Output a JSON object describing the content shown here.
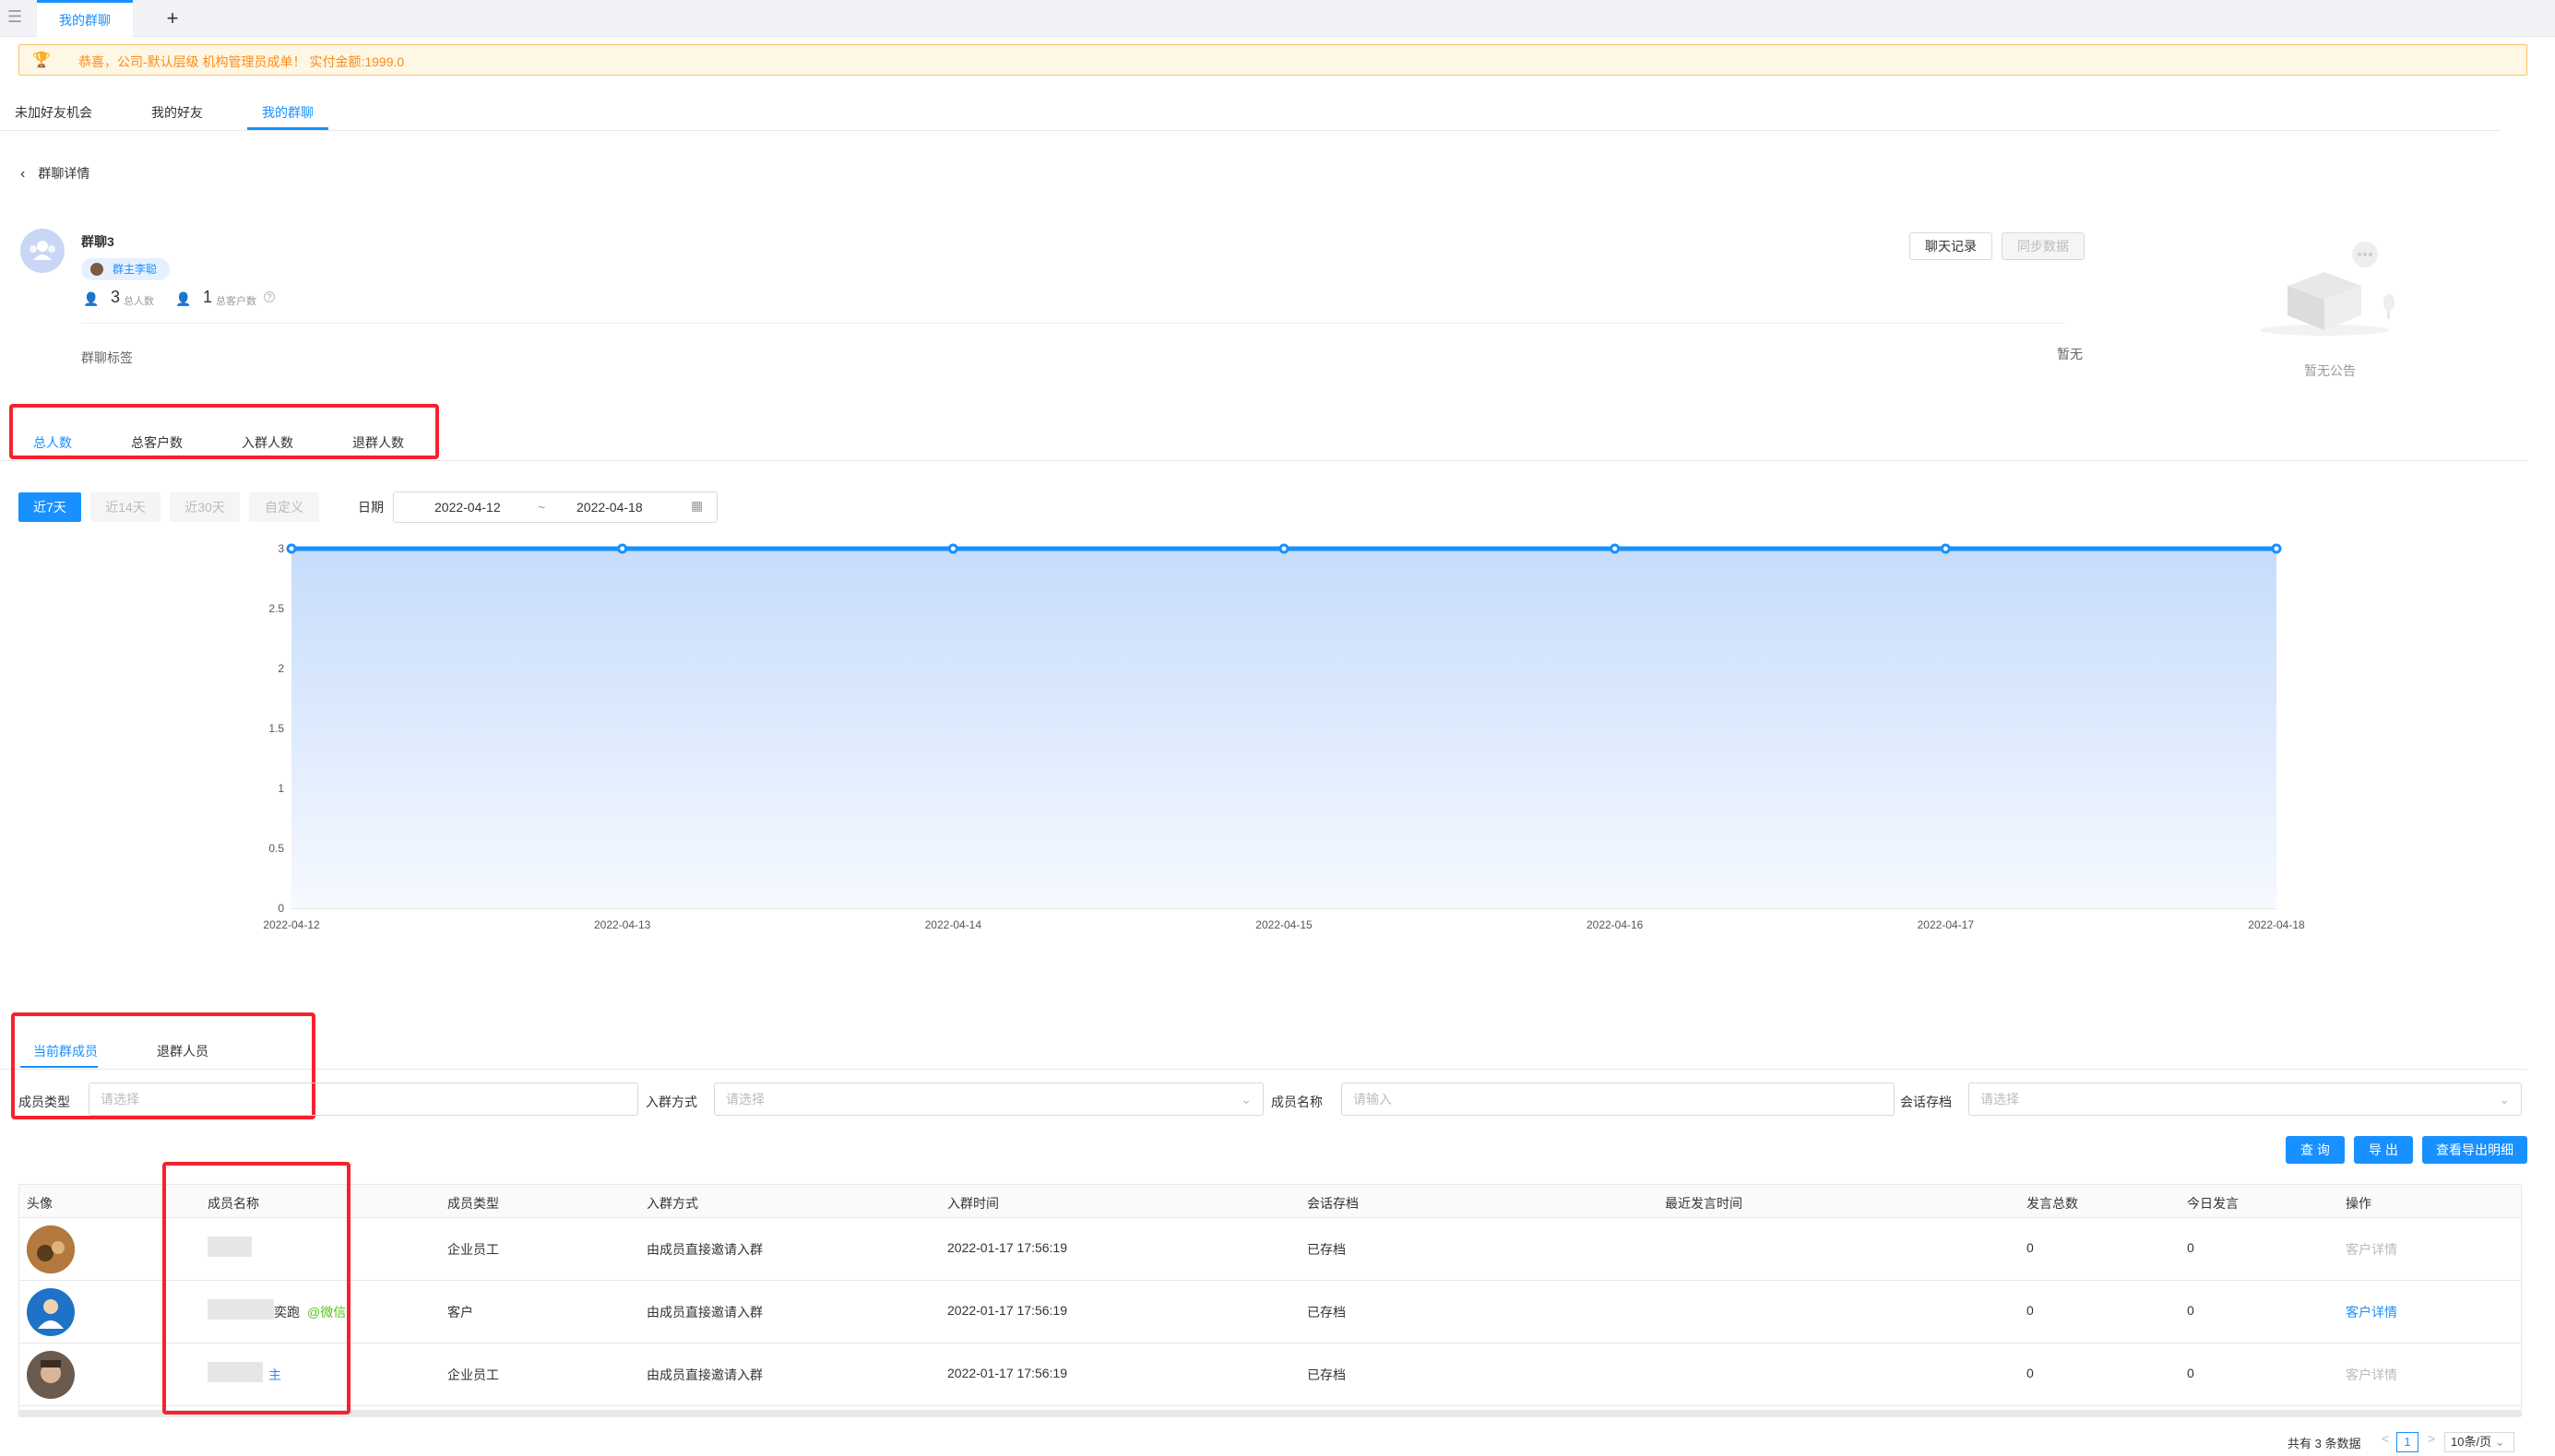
{
  "topbar": {
    "tab_label": "我的群聊",
    "add_symbol": "+"
  },
  "notice": {
    "text": "恭喜，公司-默认层级  机构管理员成单！  实付金额:1999.0"
  },
  "main_tabs": [
    "未加好友机会",
    "我的好友",
    "我的群聊"
  ],
  "back_label": "群聊详情",
  "group": {
    "name": "群聊3",
    "owner_tag": "群主李聪",
    "total_count": "3",
    "total_label": "总人数",
    "customer_count": "1",
    "customer_label": "总客户数",
    "help_icon": "?",
    "tags_label": "群聊标签",
    "tags_value": "暂无",
    "chat_record_button": "聊天记录",
    "sync_button": "同步数据",
    "announcement_empty": "暂无公告"
  },
  "stat_tabs": [
    "总人数",
    "总客户数",
    "入群人数",
    "退群人数"
  ],
  "period_buttons": [
    "近7天",
    "近14天",
    "近30天",
    "自定义"
  ],
  "date_filter": {
    "label": "日期",
    "start": "2022-04-12",
    "sep": "~",
    "end": "2022-04-18"
  },
  "chart_data": {
    "type": "area",
    "x": [
      "2022-04-12",
      "2022-04-13",
      "2022-04-14",
      "2022-04-15",
      "2022-04-16",
      "2022-04-17",
      "2022-04-18"
    ],
    "series": [
      {
        "values": [
          3,
          3,
          3,
          3,
          3,
          3,
          3
        ]
      }
    ],
    "yticks": [
      "0",
      "0.5",
      "1",
      "1.5",
      "2",
      "2.5",
      "3"
    ],
    "ylim": [
      0,
      3
    ],
    "grid": true,
    "color": "#1890ff"
  },
  "member_tabs": [
    "当前群成员",
    "退群人员"
  ],
  "filters": {
    "member_type": {
      "label": "成员类型",
      "placeholder": "请选择"
    },
    "join_method": {
      "label": "入群方式",
      "placeholder": "请选择"
    },
    "member_name": {
      "label": "成员名称",
      "placeholder": "请输入"
    },
    "session_archive": {
      "label": "会话存档",
      "placeholder": "请选择"
    }
  },
  "actions": {
    "query": "查 询",
    "export": "导 出",
    "export_detail": "查看导出明细"
  },
  "table": {
    "columns": [
      "头像",
      "成员名称",
      "成员类型",
      "入群方式",
      "入群时间",
      "会话存档",
      "最近发言时间",
      "发言总数",
      "今日发言",
      "操作"
    ],
    "rows": [
      {
        "name_suffix": "",
        "name_tag": "",
        "type": "企业员工",
        "join": "由成员直接邀请入群",
        "time": "2022-01-17 17:56:19",
        "archive": "已存档",
        "last": "",
        "total": "0",
        "today": "0",
        "op": "客户详情"
      },
      {
        "name_suffix": "奕跑",
        "name_tag": "@微信",
        "type": "客户",
        "join": "由成员直接邀请入群",
        "time": "2022-01-17 17:56:19",
        "archive": "已存档",
        "last": "",
        "total": "0",
        "today": "0",
        "op": "客户详情"
      },
      {
        "name_suffix": "主",
        "name_tag": "",
        "type": "企业员工",
        "join": "由成员直接邀请入群",
        "time": "2022-01-17 17:56:19",
        "archive": "已存档",
        "last": "",
        "total": "0",
        "today": "0",
        "op": "客户详情"
      }
    ]
  },
  "pagination": {
    "total_text": "共有 3 条数据",
    "prev": "<",
    "page": "1",
    "next": ">",
    "page_size": "10条/页"
  },
  "colors": {
    "accent": "#1890ff",
    "warning_bg": "#fff7e6",
    "warning_text": "#fa8c16",
    "annotation_red": "#f5222d"
  }
}
